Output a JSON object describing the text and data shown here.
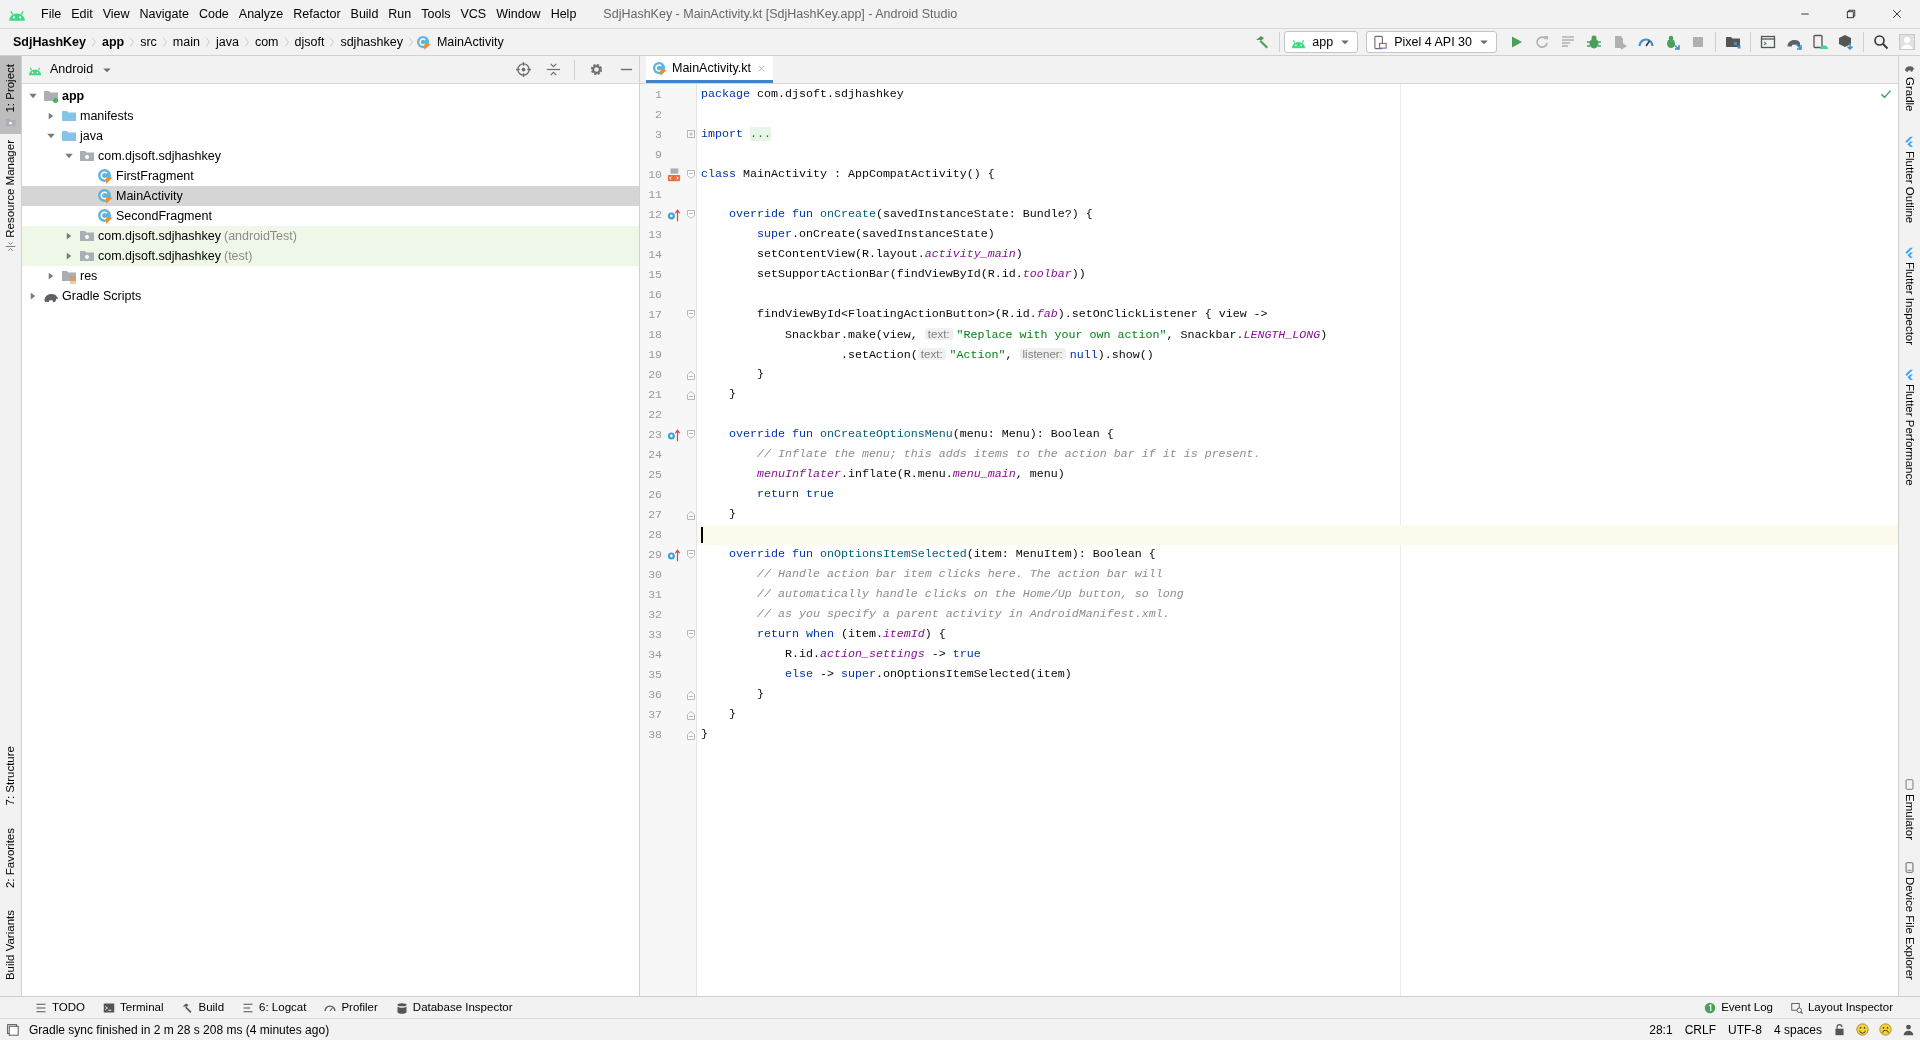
{
  "window": {
    "title": "SdjHashKey - MainActivity.kt [SdjHashKey.app] - Android Studio",
    "menu": [
      "File",
      "Edit",
      "View",
      "Navigate",
      "Code",
      "Analyze",
      "Refactor",
      "Build",
      "Run",
      "Tools",
      "VCS",
      "Window",
      "Help"
    ]
  },
  "breadcrumbs": [
    {
      "label": "SdjHashKey",
      "kind": "project"
    },
    {
      "label": "app",
      "kind": "module"
    },
    {
      "label": "src",
      "kind": "dir"
    },
    {
      "label": "main",
      "kind": "dir"
    },
    {
      "label": "java",
      "kind": "dir"
    },
    {
      "label": "com",
      "kind": "dir"
    },
    {
      "label": "djsoft",
      "kind": "dir"
    },
    {
      "label": "sdjhashkey",
      "kind": "dir"
    },
    {
      "label": "MainActivity",
      "kind": "class"
    }
  ],
  "toolbar": {
    "run_config": "app",
    "device": "Pixel 4 API 30"
  },
  "left_stripe": {
    "top": [
      {
        "label": "1: Project",
        "selected": true
      },
      {
        "label": "Resource Manager",
        "selected": false
      }
    ],
    "bottom": [
      {
        "label": "7: Structure",
        "selected": false
      },
      {
        "label": "2: Favorites",
        "selected": false
      },
      {
        "label": "Build Variants",
        "selected": false
      }
    ]
  },
  "project": {
    "view": "Android",
    "tree": [
      {
        "label": "app",
        "kind": "module",
        "expanded": true,
        "selected": false,
        "children": [
          {
            "label": "manifests",
            "kind": "folder",
            "expanded": false,
            "selected": false
          },
          {
            "label": "java",
            "kind": "folder",
            "expanded": true,
            "selected": false,
            "children": [
              {
                "label": "com.djsoft.sdjhashkey",
                "kind": "package",
                "expanded": true,
                "selected": false,
                "children": [
                  {
                    "label": "FirstFragment",
                    "kind": "class",
                    "selected": false
                  },
                  {
                    "label": "MainActivity",
                    "kind": "class",
                    "selected": true
                  },
                  {
                    "label": "SecondFragment",
                    "kind": "class",
                    "selected": false
                  }
                ]
              },
              {
                "label": "com.djsoft.sdjhashkey",
                "note": "(androidTest)",
                "kind": "test_package",
                "expanded": false,
                "selected": false
              },
              {
                "label": "com.djsoft.sdjhashkey",
                "note": "(test)",
                "kind": "test_package",
                "expanded": false,
                "selected": false
              }
            ]
          },
          {
            "label": "res",
            "kind": "res",
            "expanded": false,
            "selected": false
          }
        ]
      },
      {
        "label": "Gradle Scripts",
        "kind": "gradle",
        "expanded": false,
        "selected": false
      }
    ]
  },
  "editor": {
    "tab": {
      "label": "MainActivity.kt",
      "selected": true
    },
    "lines": [
      {
        "number": "1",
        "tokens": [
          {
            "kind": "kw",
            "text": "package"
          },
          {
            "kind": "plain",
            "text": " com.djsoft.sdjhashkey"
          }
        ]
      },
      {
        "number": "2"
      },
      {
        "number": "3",
        "folded": true,
        "tokens": [
          {
            "kind": "kw",
            "text": "import"
          },
          {
            "kind": "folded",
            "text": "..."
          }
        ]
      },
      {
        "number": "9"
      },
      {
        "number": "10",
        "layout_marker": true,
        "fold_start": true,
        "tokens": [
          {
            "kind": "kw",
            "text": "class"
          },
          {
            "kind": "plain",
            "text": " MainActivity : AppCompatActivity() {"
          }
        ]
      },
      {
        "number": "11"
      },
      {
        "number": "12",
        "override_marker": true,
        "fold_start": true,
        "tokens": [
          {
            "kind": "kw",
            "text": "    override fun "
          },
          {
            "kind": "fn",
            "text": "onCreate"
          },
          {
            "kind": "plain",
            "text": "(savedInstanceState: Bundle?) {"
          }
        ]
      },
      {
        "number": "13",
        "tokens": [
          {
            "kind": "kw",
            "text": "        super"
          },
          {
            "kind": "plain",
            "text": ".onCreate(savedInstanceState)"
          }
        ]
      },
      {
        "number": "14",
        "tokens": [
          {
            "kind": "plain",
            "text": "        setContentView(R.layout."
          },
          {
            "kind": "field",
            "text": "activity_main"
          },
          {
            "kind": "plain",
            "text": ")"
          }
        ]
      },
      {
        "number": "15",
        "tokens": [
          {
            "kind": "plain",
            "text": "        setSupportActionBar(findViewById(R.id."
          },
          {
            "kind": "field",
            "text": "toolbar"
          },
          {
            "kind": "plain",
            "text": "))"
          }
        ]
      },
      {
        "number": "16"
      },
      {
        "number": "17",
        "fold_start": true,
        "tokens": [
          {
            "kind": "plain",
            "text": "        findViewById<FloatingActionButton>(R.id."
          },
          {
            "kind": "field",
            "text": "fab"
          },
          {
            "kind": "plain",
            "text": ").setOnClickListener { view ->"
          }
        ]
      },
      {
        "number": "18",
        "tokens": [
          {
            "kind": "plain",
            "text": "            Snackbar.make(view, "
          },
          {
            "kind": "hint",
            "text": "text:"
          },
          {
            "kind": "str",
            "text": "\"Replace with your own action\""
          },
          {
            "kind": "plain",
            "text": ", Snackbar."
          },
          {
            "kind": "field",
            "text": "LENGTH_LONG"
          },
          {
            "kind": "plain",
            "text": ")"
          }
        ]
      },
      {
        "number": "19",
        "tokens": [
          {
            "kind": "plain",
            "text": "                    .setAction("
          },
          {
            "kind": "hint",
            "text": "text:"
          },
          {
            "kind": "str",
            "text": "\"Action\""
          },
          {
            "kind": "plain",
            "text": ", "
          },
          {
            "kind": "hint",
            "text": "listener:"
          },
          {
            "kind": "kw",
            "text": "null"
          },
          {
            "kind": "plain",
            "text": ").show()"
          }
        ]
      },
      {
        "number": "20",
        "fold_end": true,
        "tokens": [
          {
            "kind": "plain",
            "text": "        }"
          }
        ]
      },
      {
        "number": "21",
        "fold_end": true,
        "tokens": [
          {
            "kind": "plain",
            "text": "    }"
          }
        ]
      },
      {
        "number": "22"
      },
      {
        "number": "23",
        "override_marker": true,
        "fold_start": true,
        "tokens": [
          {
            "kind": "kw",
            "text": "    override fun "
          },
          {
            "kind": "fn",
            "text": "onCreateOptionsMenu"
          },
          {
            "kind": "plain",
            "text": "(menu: Menu): Boolean {"
          }
        ]
      },
      {
        "number": "24",
        "tokens": [
          {
            "kind": "comment",
            "text": "        // Inflate the menu; this adds items to the action bar if it is present."
          }
        ]
      },
      {
        "number": "25",
        "tokens": [
          {
            "kind": "field",
            "text": "        menuInflater"
          },
          {
            "kind": "plain",
            "text": ".inflate(R.menu."
          },
          {
            "kind": "field",
            "text": "menu_main"
          },
          {
            "kind": "plain",
            "text": ", menu)"
          }
        ]
      },
      {
        "number": "26",
        "tokens": [
          {
            "kind": "kw",
            "text": "        return true"
          }
        ]
      },
      {
        "number": "27",
        "fold_end": true,
        "tokens": [
          {
            "kind": "plain",
            "text": "    }"
          }
        ]
      },
      {
        "number": "28",
        "current": true
      },
      {
        "number": "29",
        "override_marker": true,
        "fold_start": true,
        "tokens": [
          {
            "kind": "kw",
            "text": "    override fun "
          },
          {
            "kind": "fn",
            "text": "onOptionsItemSelected"
          },
          {
            "kind": "plain",
            "text": "(item: MenuItem): Boolean {"
          }
        ]
      },
      {
        "number": "30",
        "tokens": [
          {
            "kind": "comment",
            "text": "        // Handle action bar item clicks here. The action bar will"
          }
        ]
      },
      {
        "number": "31",
        "tokens": [
          {
            "kind": "comment",
            "text": "        // automatically handle clicks on the Home/Up button, so long"
          }
        ]
      },
      {
        "number": "32",
        "tokens": [
          {
            "kind": "comment",
            "text": "        // as you specify a parent activity in AndroidManifest.xml."
          }
        ]
      },
      {
        "number": "33",
        "fold_start": true,
        "tokens": [
          {
            "kind": "kw",
            "text": "        return when"
          },
          {
            "kind": "plain",
            "text": " (item."
          },
          {
            "kind": "field",
            "text": "itemId"
          },
          {
            "kind": "plain",
            "text": ") {"
          }
        ]
      },
      {
        "number": "34",
        "tokens": [
          {
            "kind": "plain",
            "text": "            R.id."
          },
          {
            "kind": "field",
            "text": "action_settings"
          },
          {
            "kind": "plain",
            "text": " -> "
          },
          {
            "kind": "kw",
            "text": "true"
          }
        ]
      },
      {
        "number": "35",
        "tokens": [
          {
            "kind": "kw",
            "text": "            else"
          },
          {
            "kind": "plain",
            "text": " -> "
          },
          {
            "kind": "kw",
            "text": "super"
          },
          {
            "kind": "plain",
            "text": ".onOptionsItemSelected(item)"
          }
        ]
      },
      {
        "number": "36",
        "fold_end": true,
        "tokens": [
          {
            "kind": "plain",
            "text": "        }"
          }
        ]
      },
      {
        "number": "37",
        "fold_end": true,
        "tokens": [
          {
            "kind": "plain",
            "text": "    }"
          }
        ]
      },
      {
        "number": "38",
        "fold_end": true,
        "tokens": [
          {
            "kind": "plain",
            "text": "}"
          }
        ]
      }
    ]
  },
  "right_stripe": {
    "top": [
      {
        "label": "Gradle",
        "kind": "gradle"
      },
      {
        "label": "Flutter Outline",
        "kind": "flutter"
      },
      {
        "label": "Flutter Inspector",
        "kind": "flutter"
      },
      {
        "label": "Flutter Performance",
        "kind": "flutter"
      }
    ],
    "bottom": [
      {
        "label": "Emulator",
        "kind": "emulator"
      },
      {
        "label": "Device File Explorer",
        "kind": "device"
      }
    ]
  },
  "tool_windows": {
    "left": [
      "TODO",
      "Terminal",
      "Build",
      "6: Logcat",
      "Profiler",
      "Database Inspector"
    ],
    "right": [
      "Event Log",
      "Layout Inspector"
    ]
  },
  "status_bar": {
    "message": "Gradle sync finished in 2 m 28 s 208 ms (4 minutes ago)",
    "position": "28:1",
    "line_separator": "CRLF",
    "encoding": "UTF-8",
    "indent": "4 spaces"
  }
}
